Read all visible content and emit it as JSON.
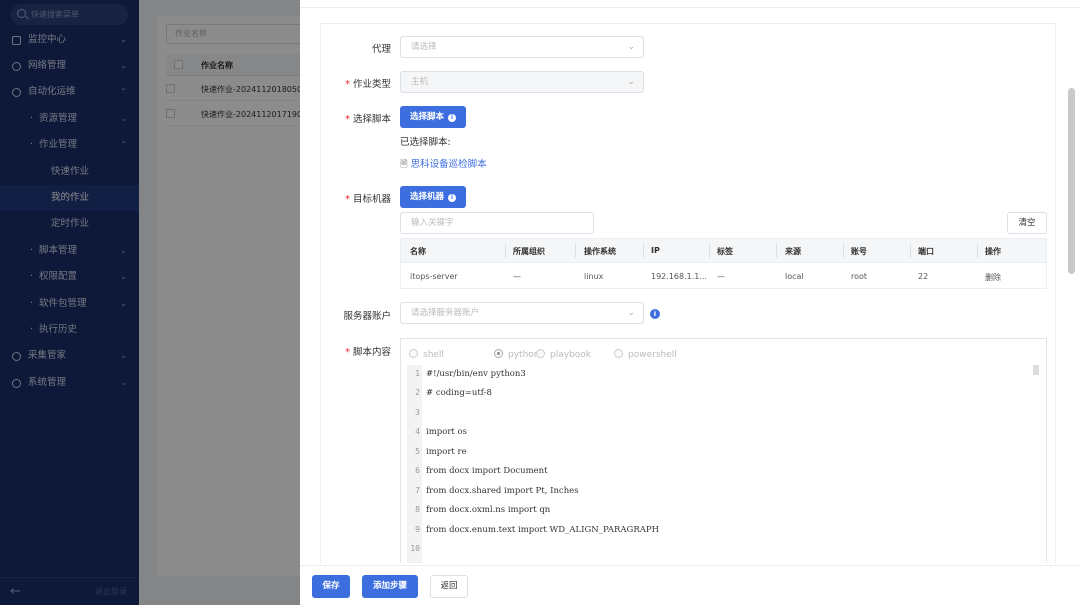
{
  "sidebar": {
    "search_placeholder": "快速搜索菜单",
    "items": [
      {
        "label": "监控中心",
        "chevron": "⌄"
      },
      {
        "label": "网络管理",
        "chevron": "⌄"
      },
      {
        "label": "自动化运维",
        "chevron": "⌃"
      },
      {
        "label": "资源管理",
        "chevron": "⌄"
      },
      {
        "label": "作业管理",
        "chevron": "⌃"
      },
      {
        "label": "快速作业"
      },
      {
        "label": "我的作业"
      },
      {
        "label": "定时作业"
      },
      {
        "label": "脚本管理",
        "chevron": "⌄"
      },
      {
        "label": "权限配置",
        "chevron": "⌄"
      },
      {
        "label": "软件包管理",
        "chevron": "⌄"
      },
      {
        "label": "执行历史"
      },
      {
        "label": "采集管家",
        "chevron": "⌄"
      },
      {
        "label": "系统管理",
        "chevron": "⌄"
      }
    ],
    "bottom_text": "退出登录",
    "collapse_icon": "arrow-left-icon"
  },
  "background": {
    "search_placeholder": "作业名称",
    "column_header": "作业名称",
    "rows": [
      "快速作业-20241120180504",
      "快速作业-20241120171900"
    ]
  },
  "form": {
    "proxy": {
      "label": "代理",
      "placeholder": "请选择"
    },
    "job_type": {
      "label": "作业类型",
      "value": "主机"
    },
    "script": {
      "label": "选择脚本",
      "button": "选择脚本",
      "selected_label": "已选择脚本:",
      "selected_name": "思科设备巡检脚本"
    },
    "target": {
      "label": "目标机器",
      "button": "选择机器",
      "keyword_placeholder": "输入关键字",
      "clear_button": "清空",
      "columns": [
        "名称",
        "所属组织",
        "操作系统",
        "IP",
        "标签",
        "来源",
        "账号",
        "端口",
        "操作"
      ],
      "rows": [
        {
          "name": "itops-server",
          "org": "—",
          "os": "linux",
          "ip": "192.168.1.1...",
          "tag": "—",
          "source": "local",
          "account": "root",
          "port": "22",
          "action": "删除"
        }
      ]
    },
    "server_account": {
      "label": "服务器账户",
      "placeholder": "请选择服务器账户"
    },
    "script_content": {
      "label": "脚本内容",
      "languages": [
        "shell",
        "python",
        "playbook",
        "powershell"
      ],
      "selected_language": "python",
      "lines": [
        "#!/usr/bin/env python3",
        "# coding=utf-8",
        "",
        "import os",
        "import re",
        "from docx import Document",
        "from docx.shared import Pt, Inches",
        "from docx.oxml.ns import qn",
        "from docx.enum.text import WD_ALIGN_PARAGRAPH",
        ""
      ],
      "line_numbers": [
        "1",
        "2",
        "3",
        "4",
        "5",
        "6",
        "7",
        "8",
        "9",
        "10"
      ]
    }
  },
  "footer": {
    "save": "保存",
    "add_step": "添加步骤",
    "back": "返回"
  },
  "colors": {
    "primary": "#3d6ee0",
    "sidebar": "#1b2e6b",
    "danger": "#f5222d"
  }
}
